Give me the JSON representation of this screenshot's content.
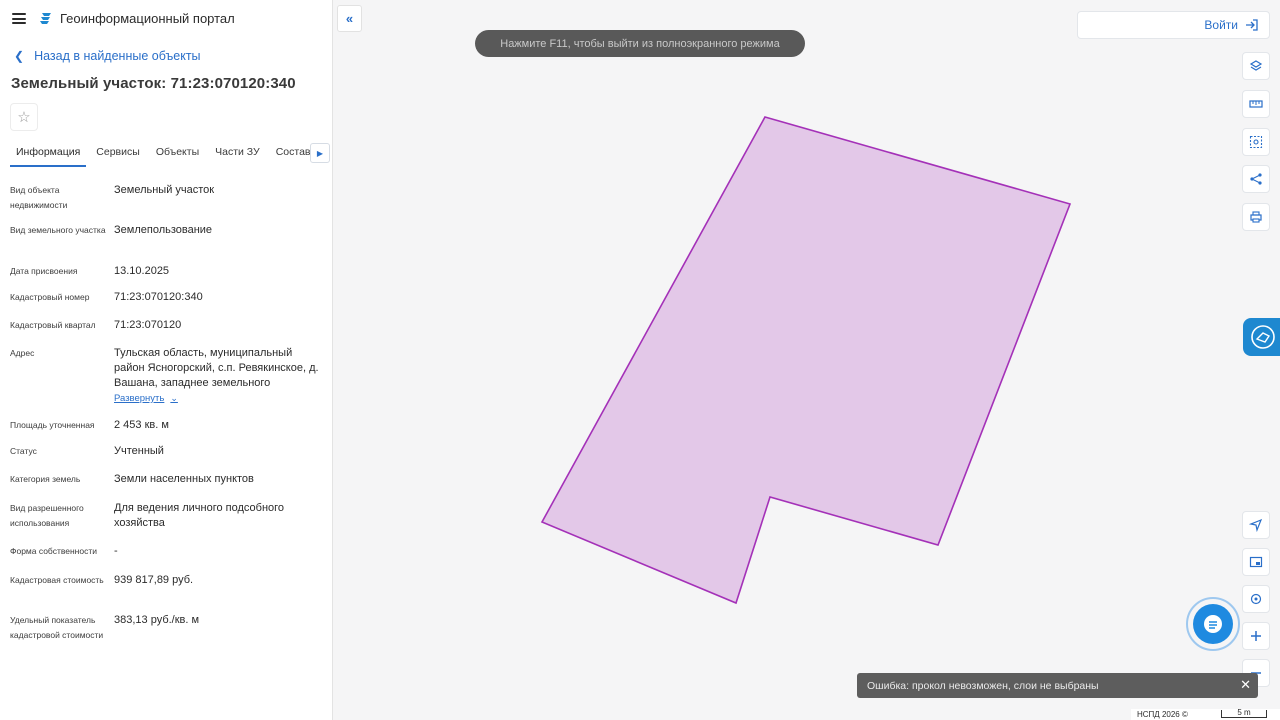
{
  "app": {
    "title": "Геоинформационный портал"
  },
  "nav": {
    "back_label": "Назад в найденные объекты"
  },
  "parcel": {
    "title": "Земельный участок: 71:23:070120:340"
  },
  "tabs": [
    {
      "label": "Информация",
      "active": true
    },
    {
      "label": "Сервисы"
    },
    {
      "label": "Объекты"
    },
    {
      "label": "Части ЗУ"
    },
    {
      "label": "Состав"
    }
  ],
  "info": {
    "object_type": {
      "label": "Вид объекта недвижимости",
      "value": "Земельный участок"
    },
    "land_type": {
      "label": "Вид земельного участка",
      "value": "Землепользование"
    },
    "assigned_date": {
      "label": "Дата присвоения",
      "value": "13.10.2025"
    },
    "cadastral_number": {
      "label": "Кадастровый номер",
      "value": "71:23:070120:340"
    },
    "cadastral_block": {
      "label": "Кадастровый квартал",
      "value": "71:23:070120"
    },
    "address": {
      "label": "Адрес",
      "value": "Тульская область, муниципальный район Ясногорский, с.п. Ревякинское, д. Вашана, западнее земельного",
      "expand_label": "Развернуть"
    },
    "area": {
      "label": "Площадь уточненная",
      "value": "2 453 кв. м"
    },
    "status": {
      "label": "Статус",
      "value": "Учтенный"
    },
    "category": {
      "label": "Категория земель",
      "value": "Земли населенных пунктов"
    },
    "permitted_use": {
      "label": "Вид разрешенного использования",
      "value": "Для ведения личного подсобного хозяйства"
    },
    "ownership": {
      "label": "Форма собственности",
      "value": "-"
    },
    "cadastral_value": {
      "label": "Кадастровая стоимость",
      "value": "939 817,89 руб."
    },
    "specific_value": {
      "label": "Удельный показатель кадастровой стоимости",
      "value": "383,13 руб./кв. м"
    }
  },
  "map": {
    "fullscreen_notice": "Нажмите F11, чтобы выйти из полноэкранного режима",
    "login_label": "Войти",
    "error_message": "Ошибка: прокол невозможен, слои не выбраны",
    "footer_label": "НСПД 2026 ©",
    "scale_label": "5 m",
    "parcel_fill": "#e3c8e8",
    "parcel_stroke": "#a431b8"
  },
  "colors": {
    "accent": "#2a6fc9",
    "chat": "#1f8ae0"
  }
}
